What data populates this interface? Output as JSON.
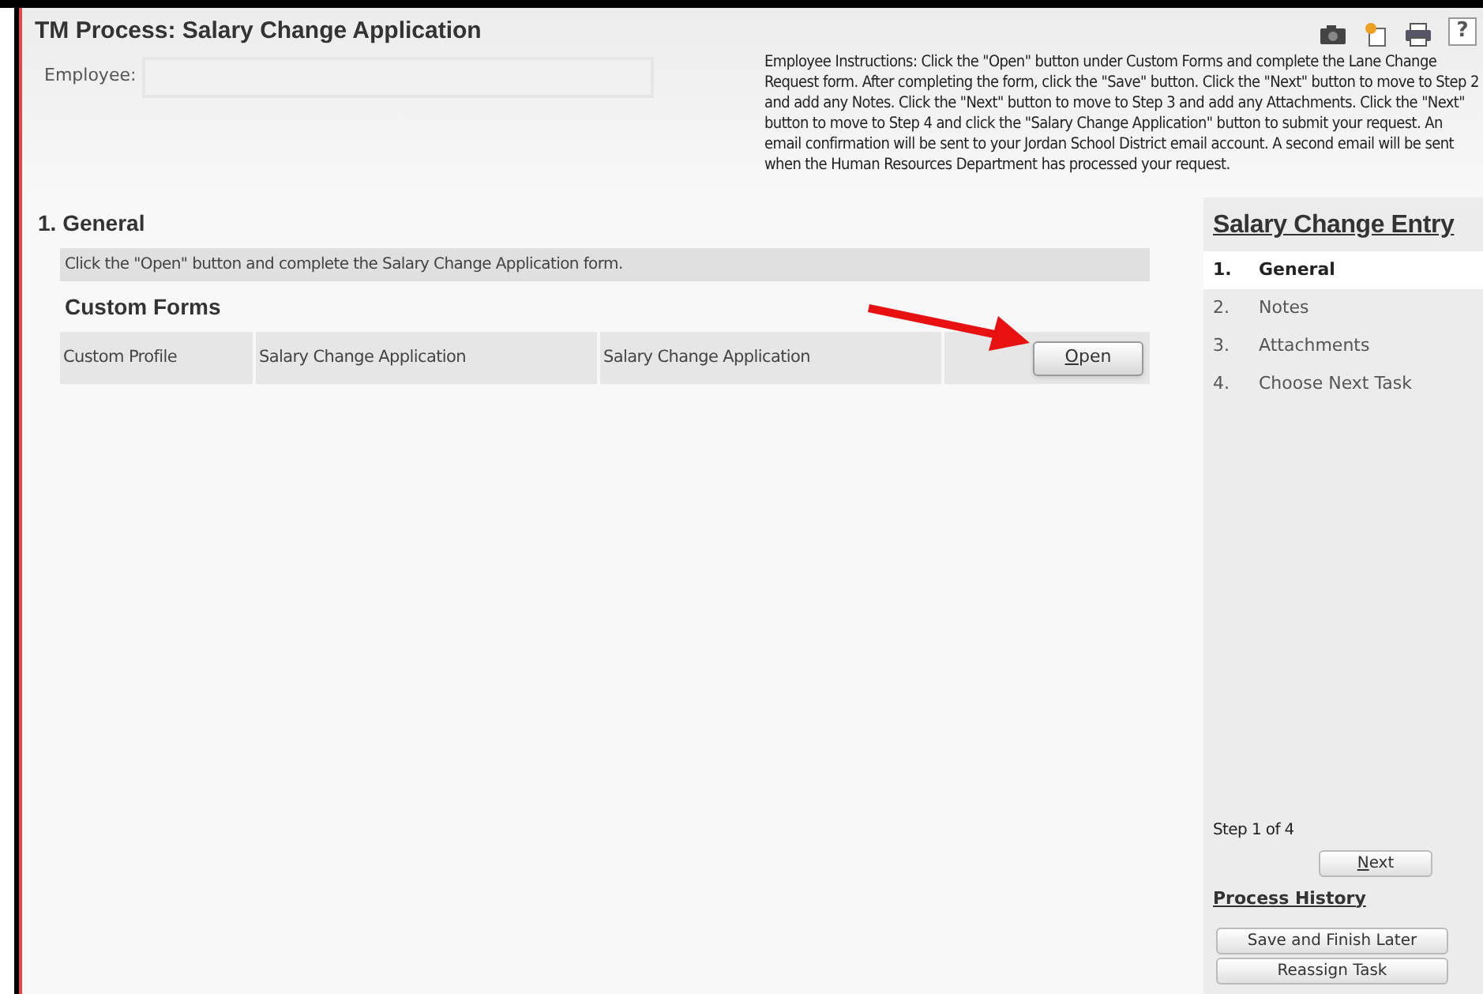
{
  "title": "TM Process: Salary Change Application",
  "toolbar": [
    {
      "kind": "camera"
    },
    {
      "kind": "document"
    },
    {
      "kind": "print"
    },
    {
      "kind": "help",
      "label": "?"
    }
  ],
  "employee": {
    "label": "Employee:"
  },
  "instructions": "Employee Instructions: Click the \"Open\" button under Custom Forms and complete the Lane Change Request form. After completing the form, click the \"Save\" button. Click the \"Next\" button to move to Step 2 and add any Notes. Click the \"Next\" button to move to Step 3 and add any Attachments. Click the \"Next\" button to move to Step 4 and click the \"Salary Change Application\" button to submit your request. An email confirmation will be sent to your Jordan School District email account. A second email will be sent when the Human Resources Department has processed your request.",
  "section": {
    "title": "1. General",
    "hint": "Click the \"Open\" button and complete the Salary Change Application form.",
    "subtitle": "Custom Forms",
    "rows": [
      {
        "cells": [
          "Custom Profile",
          "Salary Change Application",
          "Salary Change Application"
        ],
        "button": "Open"
      }
    ]
  },
  "sidebar": {
    "title": "Salary Change Entry",
    "steps": [
      {
        "number": "1.",
        "label": "General",
        "selected": true
      },
      {
        "number": "2.",
        "label": "Notes",
        "selected": false
      },
      {
        "number": "3.",
        "label": "Attachments",
        "selected": false
      },
      {
        "number": "4.",
        "label": "Choose Next Task",
        "selected": false
      }
    ],
    "progress": "Step 1 of 4",
    "next_button": "Next",
    "history_link": "Process History",
    "buttons": [
      "Save and Finish Later",
      "Reassign Task"
    ]
  }
}
